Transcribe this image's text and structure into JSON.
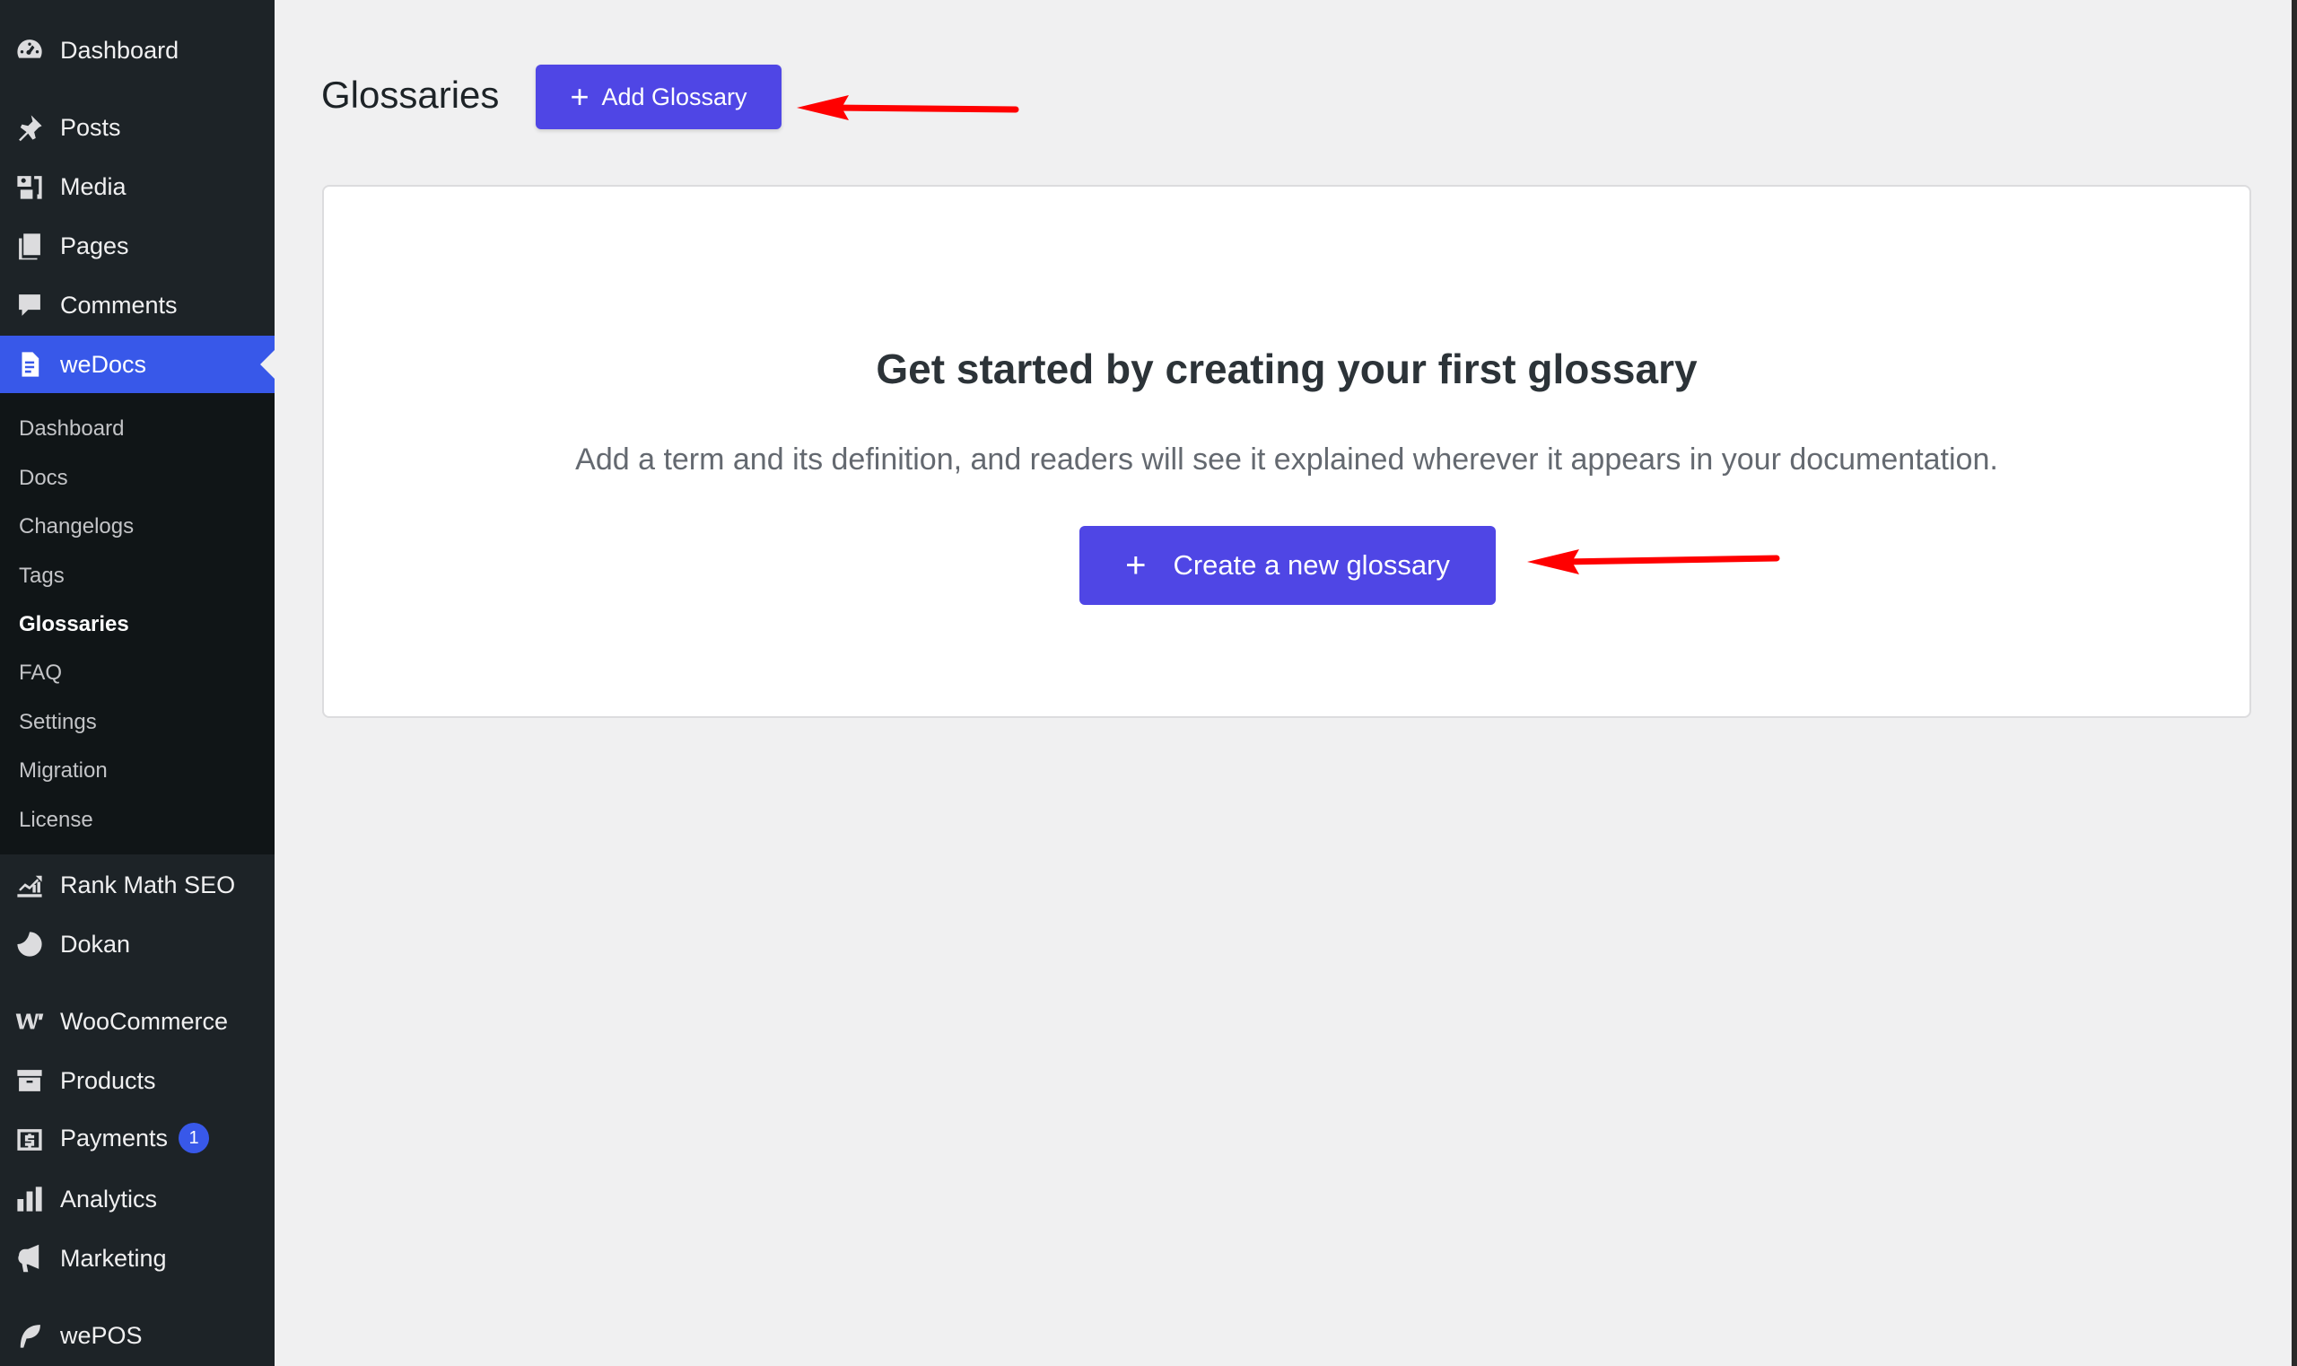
{
  "sidebar": {
    "top_items": [
      {
        "label": "Dashboard",
        "icon": "dashboard-icon"
      },
      {
        "label": "Posts",
        "icon": "pin-icon"
      },
      {
        "label": "Media",
        "icon": "media-icon"
      },
      {
        "label": "Pages",
        "icon": "pages-icon"
      },
      {
        "label": "Comments",
        "icon": "comment-icon"
      },
      {
        "label": "weDocs",
        "icon": "wedocs-icon"
      }
    ],
    "submenu": [
      "Dashboard",
      "Docs",
      "Changelogs",
      "Tags",
      "Glossaries",
      "FAQ",
      "Settings",
      "Migration",
      "License"
    ],
    "current_submenu": "Glossaries",
    "bottom_items": [
      {
        "label": "Rank Math SEO",
        "icon": "rank-math-icon"
      },
      {
        "label": "Dokan",
        "icon": "dokan-icon"
      },
      {
        "label": "WooCommerce",
        "icon": "woocommerce-icon"
      },
      {
        "label": "Products",
        "icon": "archive-icon"
      },
      {
        "label": "Payments",
        "icon": "dollar-icon",
        "badge": "1"
      },
      {
        "label": "Analytics",
        "icon": "bar-chart-icon"
      },
      {
        "label": "Marketing",
        "icon": "megaphone-icon"
      },
      {
        "label": "wePOS",
        "icon": "wepos-icon"
      }
    ]
  },
  "main": {
    "title": "Glossaries",
    "add_button": "Add Glossary",
    "empty_state": {
      "heading": "Get started by creating your first glossary",
      "description": "Add a term and its definition, and readers will see it explained wherever it appears in your documentation.",
      "button": "Create a new glossary"
    }
  },
  "colors": {
    "sidebar_bg": "#1d2327",
    "submenu_bg": "#101517",
    "active": "#3858e9",
    "primary_button": "#4f46e5",
    "annotation_arrow": "#ff0000"
  }
}
